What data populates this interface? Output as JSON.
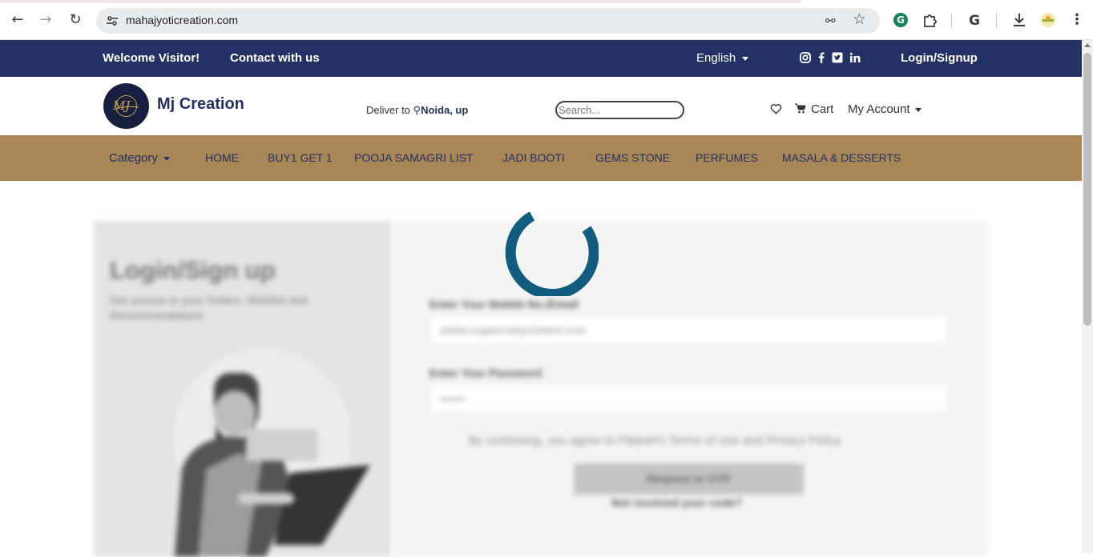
{
  "browser": {
    "url": "mahajyoticreation.com",
    "icons": [
      "back-icon",
      "forward-icon",
      "reload-icon",
      "site-settings-icon",
      "password-key-icon",
      "bookmark-star-icon",
      "grammarly-icon",
      "extensions-icon",
      "google-icon",
      "download-icon",
      "profile-avatar-icon",
      "menu-kebab-icon"
    ]
  },
  "topbar": {
    "welcome": "Welcome Visitor!",
    "contact": "Contact with us",
    "language": "English",
    "login": "Login/Signup",
    "social": [
      "instagram-icon",
      "facebook-icon",
      "twitter-icon",
      "linkedin-icon"
    ]
  },
  "header": {
    "logo_text": "MJ",
    "brand": "Mj Creation",
    "deliver_label": "Deliver to",
    "deliver_location": "Noida, up",
    "search_placeholder": "Search...",
    "cart": "Cart",
    "account": "My Account"
  },
  "menu": {
    "items": [
      {
        "label": "Category",
        "dropdown": true
      },
      {
        "label": "HOME"
      },
      {
        "label": "BUY1 GET 1"
      },
      {
        "label": "POOJA SAMAGRI LIST"
      },
      {
        "label": "JADI BOOTI"
      },
      {
        "label": "GEMS STONE"
      },
      {
        "label": "PERFUMES"
      },
      {
        "label": "MASALA & DESSERTS"
      }
    ]
  },
  "login": {
    "title": "Login/Sign up",
    "subtitle": "Get access to your Orders, Wishlist and Recommendations",
    "mobile_label": "Enter Your Mobile No./Email",
    "mobile_value": "ankita.sugiarrvalayoshtech.com",
    "password_label": "Enter Your Password",
    "password_value": "•••••••",
    "terms": "By continuing, you agree to Flipkart's Terms of Use and Privacy Policy.",
    "otp_button": "Request to OTP",
    "not_received": "Not received your code?"
  },
  "colors": {
    "topbar": "#243164",
    "menubar": "#a88655",
    "spinner": "#125c80"
  }
}
